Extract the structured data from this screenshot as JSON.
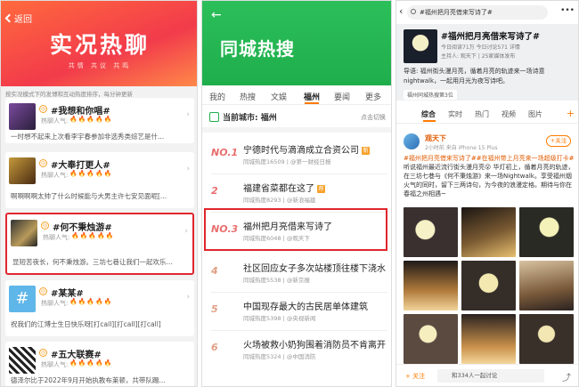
{
  "panel1": {
    "back_label": "返回",
    "title": "实况热聊",
    "subtitle": "共情 共议 共鸣",
    "notice": "按实况模式下的发博和互动热度排序，每分钟更新",
    "heat_label": "热聊人气:",
    "flames": "🔥🔥🔥🔥🔥",
    "topics": [
      {
        "name": "#我想和你唱#",
        "summary": "一时想不起来上次看李宇春参加非选秀类综艺是什..."
      },
      {
        "name": "#大奉打更人#",
        "summary": "啊啊啊啊太帅了什么时候能与大男主许七安见面呢[..."
      },
      {
        "name": "#何不秉烛游#",
        "summary": "显短苦夜长，何不秉烛游。三坊七巷让我们一起欢乐..."
      },
      {
        "name": "#某某#",
        "summary": "祝我们的江博士生日快乐呀[打call][打call][打call]"
      },
      {
        "name": "#五大联赛#",
        "summary": "德泽尔比于2022年9月开始执教布莱顿，共带队踢..."
      }
    ]
  },
  "panel2": {
    "title": "同城热搜",
    "tabs": [
      "我的",
      "热搜",
      "文娱",
      "福州",
      "要闻",
      "更多"
    ],
    "current_city": "当前城市: 福州",
    "switch_label": "点击切换",
    "items": [
      {
        "rank": "NO.1",
        "title": "宁德时代与滴滴成立合资公司",
        "sub": "同城热度16509 | @第一财经日报"
      },
      {
        "rank": "2",
        "title": "福建省菜都在这了",
        "sub": "同城热度8293 | @新浪福建"
      },
      {
        "rank": "NO.3",
        "title": "福州把月亮借来写诗了",
        "sub": "同城热度6048 | @观天下"
      },
      {
        "rank": "4",
        "title": "社区回应女子多次站楼顶往楼下浇水",
        "sub": "同城热度5538 | @新京报"
      },
      {
        "rank": "5",
        "title": "中国现存最大的古民居单体建筑",
        "sub": "同城热度5398 | @央视新闻"
      },
      {
        "rank": "6",
        "title": "火场被救小奶狗围着消防员不肯离开",
        "sub": "同城热度5324 | @中国消防"
      }
    ]
  },
  "panel3": {
    "search_text": "#福州把月亮借来写诗了#",
    "topic": "#福州把月亮借来写诗了#",
    "meta": "今日阅读71万  今日讨论571  详情",
    "host": "主持人: 观天下 | 25家媒体发布",
    "guide": "导语: 福州街头漫月亮，循着月亮的轨迹来一场诗意nightwalk，一起用月光为夜写诗吧。",
    "chip": "福州同城热搜第3位",
    "tabs": [
      "综合",
      "实时",
      "热门",
      "视频",
      "图片"
    ],
    "post_name": "观天下",
    "post_meta": "2小时前  来自 iPhone 15 Plus",
    "follow_label": "+关注",
    "post_prefix": "#福州把月亮借来写诗了##在福州带上月亮来一场超级打卡# ",
    "post_text": "听说福州最近流行街头漫月亮😮 华灯初上，循着月亮的轨迹，在三坊七巷与《何不秉烛游》来一场Nightwalk。享受福州烟火气的同时，留下三两诗句，为今夜的浪漫定格。期待与你在春福之州相遇~",
    "foot_follow": "+ 关注",
    "foot_input": "和334人一起讨论",
    "colors": {
      "accent": "#ff7a00",
      "red": "#e0262d",
      "green": "#1fae4c"
    }
  }
}
